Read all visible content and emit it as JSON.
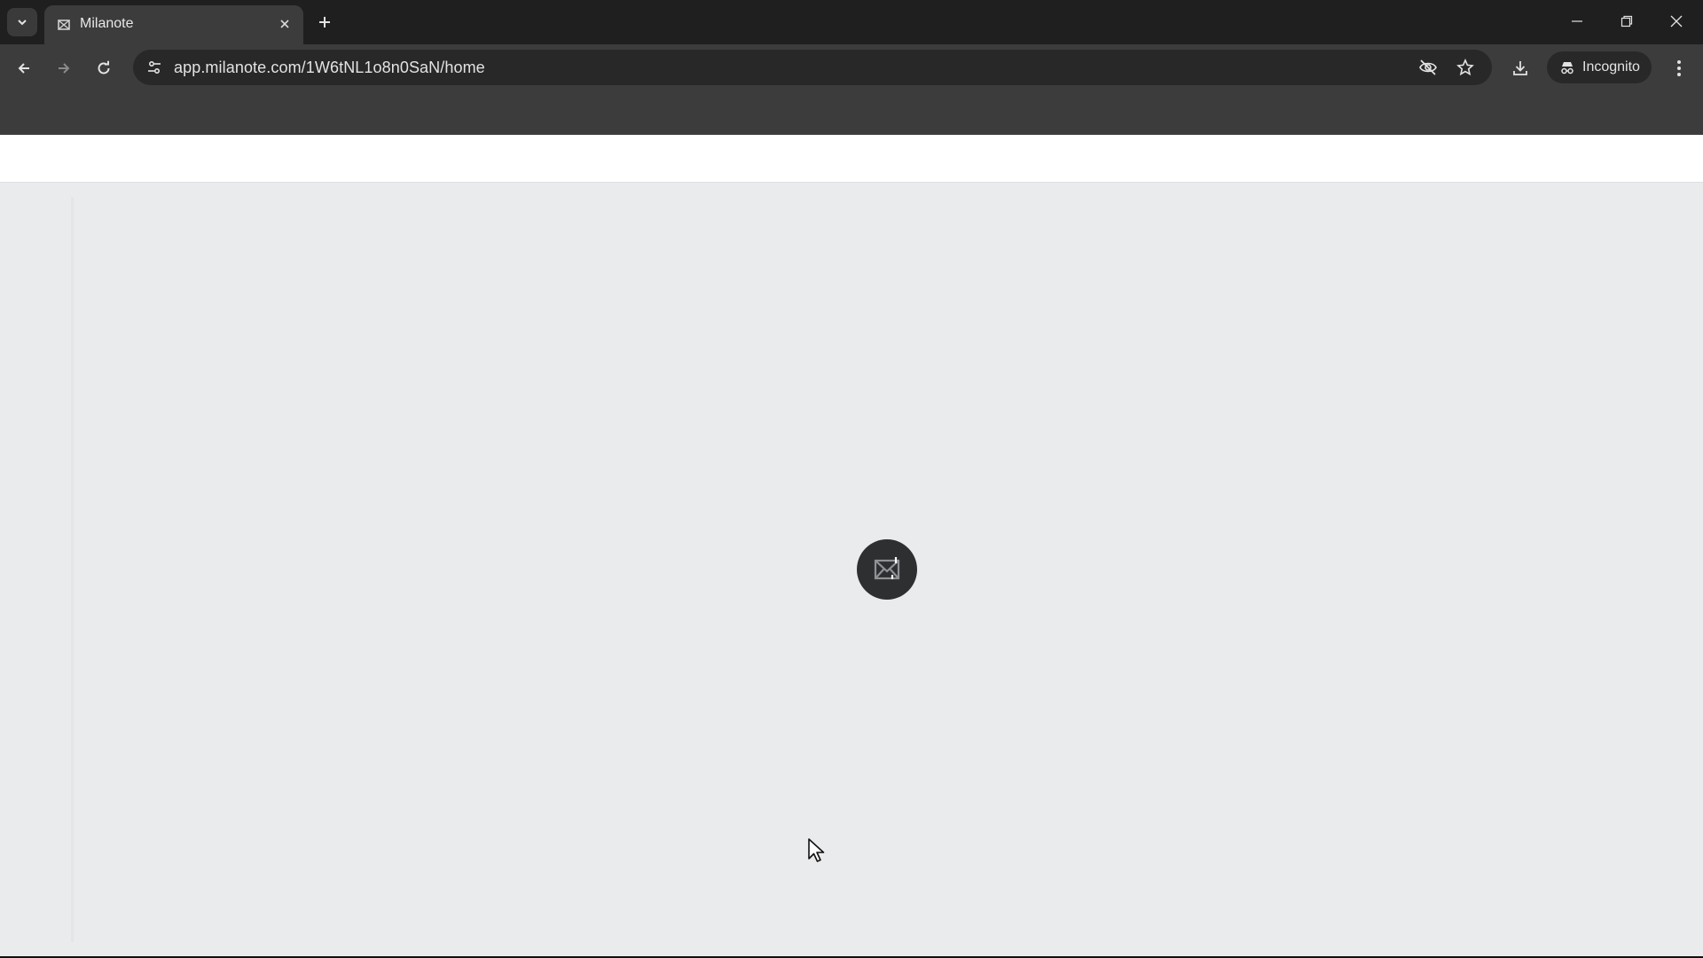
{
  "browser": {
    "tab": {
      "title": "Milanote",
      "favicon": "milanote-logo-icon"
    },
    "address_bar": {
      "url": "app.milanote.com/1W6tNL1o8n0SaN/home"
    },
    "incognito_label": "Incognito",
    "icons": {
      "tab_search": "chevron-down-icon",
      "tab_close": "close-icon",
      "new_tab": "plus-icon",
      "minimize": "minimize-icon",
      "restore": "restore-icon",
      "close": "close-icon",
      "back": "arrow-left-icon",
      "forward": "arrow-right-icon",
      "reload": "reload-icon",
      "site_info": "tune-icon",
      "tracking": "eye-off-icon",
      "bookmark": "star-icon",
      "download": "download-icon",
      "incognito": "incognito-icon",
      "menu": "more-vertical-icon"
    }
  },
  "page": {
    "state": "loading",
    "loader_icon": "milanote-logo-icon"
  },
  "colors": {
    "tabstrip": "#1f1f1f",
    "toolbar": "#3c3c3c",
    "page_bg": "#eaebed",
    "loader_bg": "#2d2f31"
  }
}
